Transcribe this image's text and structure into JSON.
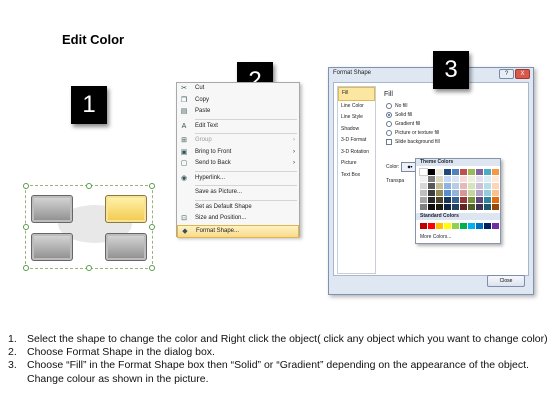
{
  "title": "Edit Color",
  "steps": [
    "1",
    "2",
    "3"
  ],
  "context_menu": {
    "items": [
      {
        "label": "Cut",
        "icon": "scissors-icon",
        "glyph": "✂"
      },
      {
        "label": "Copy",
        "icon": "copy-icon",
        "glyph": "❐"
      },
      {
        "label": "Paste",
        "icon": "paste-icon",
        "glyph": "▤"
      },
      {
        "label": "Edit Text",
        "icon": "edit-text-icon",
        "glyph": "A"
      },
      {
        "label": "Group",
        "icon": "group-icon",
        "glyph": "⊞",
        "disabled": true,
        "submenu": true
      },
      {
        "label": "Bring to Front",
        "icon": "bring-front-icon",
        "glyph": "▣",
        "submenu": true
      },
      {
        "label": "Send to Back",
        "icon": "send-back-icon",
        "glyph": "▢",
        "submenu": true
      },
      {
        "label": "Hyperlink...",
        "icon": "hyperlink-icon",
        "glyph": "◉"
      },
      {
        "label": "Save as Picture...",
        "icon": "",
        "glyph": ""
      },
      {
        "label": "Set as Default Shape",
        "icon": "",
        "glyph": ""
      },
      {
        "label": "Size and Position...",
        "icon": "size-position-icon",
        "glyph": "⊡"
      },
      {
        "label": "Format Shape...",
        "icon": "format-shape-icon",
        "glyph": "◆",
        "highlighted": true
      }
    ]
  },
  "dialog": {
    "title": "Format Shape",
    "nav": [
      "Fill",
      "Line Color",
      "Line Style",
      "Shadow",
      "3-D Format",
      "3-D Rotation",
      "Picture",
      "Text Box"
    ],
    "selected_nav": "Fill",
    "fill_heading": "Fill",
    "options": [
      {
        "label": "No fill",
        "type": "radio",
        "checked": false
      },
      {
        "label": "Solid fill",
        "type": "radio",
        "checked": true
      },
      {
        "label": "Gradient fill",
        "type": "radio",
        "checked": false
      },
      {
        "label": "Picture or texture fill",
        "type": "radio",
        "checked": false
      },
      {
        "label": "Slide background fill",
        "type": "checkbox",
        "checked": false
      }
    ],
    "color_label": "Color:",
    "transparency_label": "Transpa",
    "close_label": "Close",
    "help_button": "?",
    "close_x": "X"
  },
  "palette": {
    "theme_heading": "Theme Colors",
    "standard_heading": "Standard Colors",
    "more_colors": "More Colors...",
    "theme_colors": [
      "#ffffff",
      "#000000",
      "#eeece1",
      "#1f497d",
      "#4f81bd",
      "#c0504d",
      "#9bbb59",
      "#8064a2",
      "#4bacc6",
      "#f79646",
      "#f2f2f2",
      "#7f7f7f",
      "#ddd9c3",
      "#c6d9f0",
      "#dbe5f1",
      "#f2dcdb",
      "#ebf1dd",
      "#e5e0ec",
      "#dbeef3",
      "#fdeada",
      "#d8d8d8",
      "#595959",
      "#c4bd97",
      "#8db3e2",
      "#b8cce4",
      "#e5b9b7",
      "#d7e3bc",
      "#ccc1d9",
      "#b7dde8",
      "#fbd5b5",
      "#bfbfbf",
      "#3f3f3f",
      "#938953",
      "#548dd4",
      "#95b3d7",
      "#d99694",
      "#c3d69b",
      "#b2a2c7",
      "#92cddc",
      "#fac08f",
      "#a5a5a5",
      "#262626",
      "#494429",
      "#17365d",
      "#366092",
      "#953734",
      "#76923c",
      "#5f497a",
      "#31859b",
      "#e36c09",
      "#7f7f7f",
      "#0c0c0c",
      "#1d1b10",
      "#0f243e",
      "#244061",
      "#632423",
      "#4f6128",
      "#3f3151",
      "#205867",
      "#974806"
    ],
    "standard_colors": [
      "#c00000",
      "#ff0000",
      "#ffc000",
      "#ffff00",
      "#92d050",
      "#00b050",
      "#00b0f0",
      "#0070c0",
      "#002060",
      "#7030a0"
    ]
  },
  "instructions": [
    {
      "num": "1.",
      "text": "Select the shape to change the color and Right click the object( click any object which you want to change color)"
    },
    {
      "num": "2.",
      "text": "Choose Format Shape in the dialog box."
    },
    {
      "num": "3.",
      "text": "Choose “Fill” in the Format Shape box then “Solid” or “Gradient” depending on the appearance of the object. Change colour as shown in the picture."
    }
  ]
}
